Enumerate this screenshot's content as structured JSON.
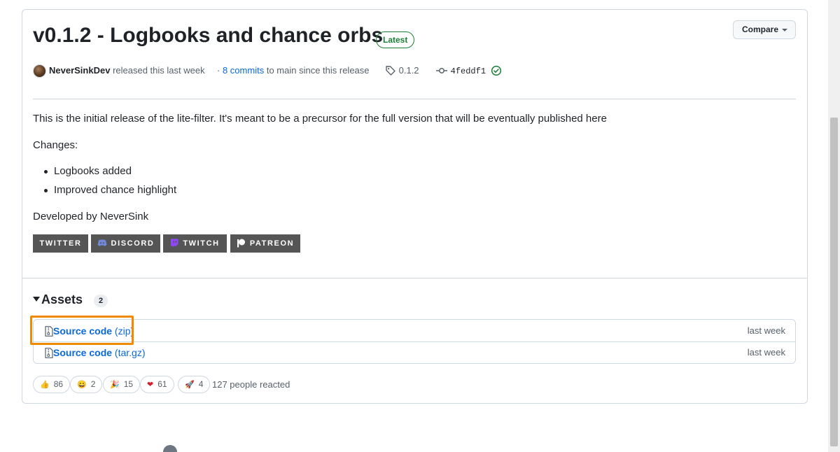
{
  "release": {
    "title": "v0.1.2 - Logbooks and chance orbs",
    "latest_label": "Latest",
    "compare_label": "Compare",
    "author": "NeverSinkDev",
    "released_text": "released this last week",
    "commits_prefix": "·",
    "commits_link": "8 commits",
    "commits_suffix": "to main since this release",
    "tag": "0.1.2",
    "commit_hash": "4feddf1"
  },
  "body": {
    "intro": "This is the initial release of the lite-filter. It's meant to be a precursor for the full version that will be eventually published here",
    "changes_heading": "Changes:",
    "changes": [
      "Logbooks added",
      "Improved chance highlight"
    ],
    "developed_by": "Developed by NeverSink",
    "badges": [
      "TWITTER",
      "DISCORD",
      "TWITCH",
      "PATREON"
    ]
  },
  "assets": {
    "heading": "Assets",
    "count": "2",
    "items": [
      {
        "name": "Source code",
        "ext": "(zip)",
        "time": "last week"
      },
      {
        "name": "Source code",
        "ext": "(tar.gz)",
        "time": "last week"
      }
    ]
  },
  "reactions": {
    "items": [
      {
        "emoji": "👍",
        "count": "86"
      },
      {
        "emoji": "😄",
        "count": "2"
      },
      {
        "emoji": "🎉",
        "count": "15"
      },
      {
        "emoji": "❤",
        "count": "61"
      },
      {
        "emoji": "🚀",
        "count": "4"
      }
    ],
    "summary": "127 people reacted"
  },
  "colors": {
    "link": "#0969da",
    "latest_badge": "#1a7f37",
    "highlight": "#f08a00",
    "badge_bg": "#555555"
  }
}
